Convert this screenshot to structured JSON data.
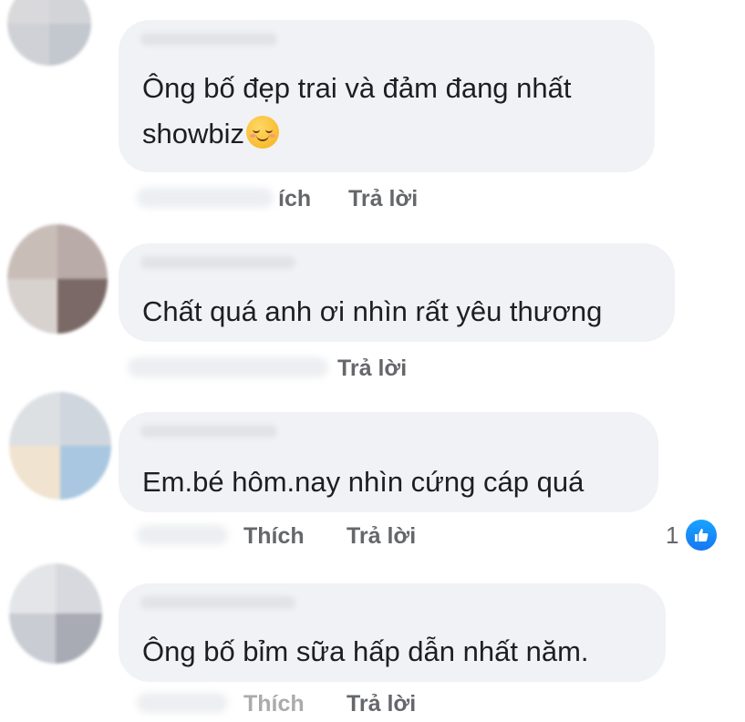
{
  "comments": [
    {
      "text_line1": "Ông bố đẹp trai và đảm đang nhất",
      "text_line2": "showbiz",
      "emoji": "smiling-face-icon",
      "like_label": "ích",
      "reply_label": "Trả lời"
    },
    {
      "text": "Chất quá anh ơi nhìn rất yêu thương",
      "reply_label": "Trả lời"
    },
    {
      "text": "Em.bé hôm.nay nhìn cứng cáp quá",
      "like_label": "Thích",
      "reply_label": "Trả lời",
      "reaction_count": "1",
      "reaction_icon": "like-icon"
    },
    {
      "text": "Ông bố bỉm sữa hấp dẫn nhất năm.",
      "like_label": "Thích",
      "reply_label": "Trả lời"
    }
  ],
  "colors": {
    "bubble": "#f0f2f5",
    "action_text": "#65676b",
    "like_blue": "#1877f2"
  }
}
